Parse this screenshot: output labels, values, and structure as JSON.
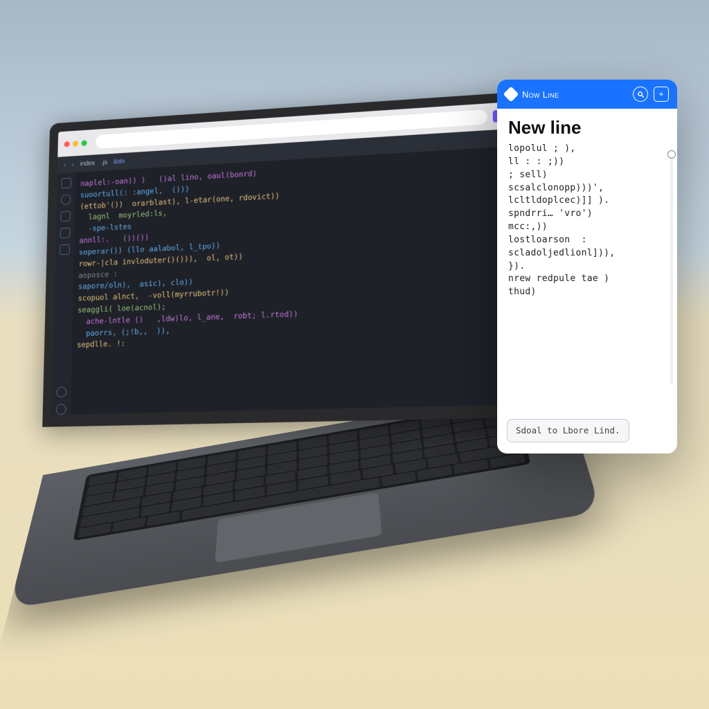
{
  "browser": {
    "tab_title": "index.js",
    "tabs": [
      {
        "label": "index"
      },
      {
        "label": ".js"
      },
      {
        "label": "iloln"
      }
    ]
  },
  "code_lines": [
    {
      "cls": "kw",
      "text": "naplel:-oan)) )   ()al lino, oaul(bonrd)"
    },
    {
      "cls": "fn",
      "text": "suoortull(: :angel,  ()))"
    },
    {
      "cls": "pr",
      "text": "(ettob'())  orarblast), l-etar(one, rdovict))"
    },
    {
      "cls": "st",
      "text": "  lagnl  moyrled:ls,"
    },
    {
      "cls": "fn",
      "text": "  -spe-lstes"
    },
    {
      "cls": "kw",
      "text": "annll:.   ())())"
    },
    {
      "cls": "fn",
      "text": "soperar()) (llo aalabol, l_tpo))"
    },
    {
      "cls": "pr",
      "text": "rowr-|cla invloduter()())),  ol, ot))"
    },
    {
      "cls": "cm",
      "text": "aoposce :"
    },
    {
      "cls": "fn",
      "text": "sapore/oln),  asic), clo))"
    },
    {
      "cls": "pr",
      "text": "scopuol alnct,  -voll(myrrubotr!))"
    },
    {
      "cls": "st",
      "text": "seaggli( loe(acnol);"
    },
    {
      "cls": "kw",
      "text": "  ache-lntle ()   ,ldw)lo, l_ane,  robt; l.rtod))"
    },
    {
      "cls": "fn",
      "text": "  paorrs, (;!b,,  )),"
    },
    {
      "cls": "pr",
      "text": "sepdlle. !:"
    }
  ],
  "panel": {
    "header_title": "Now Line",
    "heading": "New line",
    "body_text": "lopolul ; ),\nll : : ;))\n; sell)\nscsalclonopp)))',\nlcltldoplcec)]] ).\nspndrri… 'vro')\nmcc:,))\nlostloarson  :\nscladoljedlionl])),\n}).\nnrew redpule tae )\nthud)",
    "button_label": "Sdoal to\nLbore Lind."
  }
}
